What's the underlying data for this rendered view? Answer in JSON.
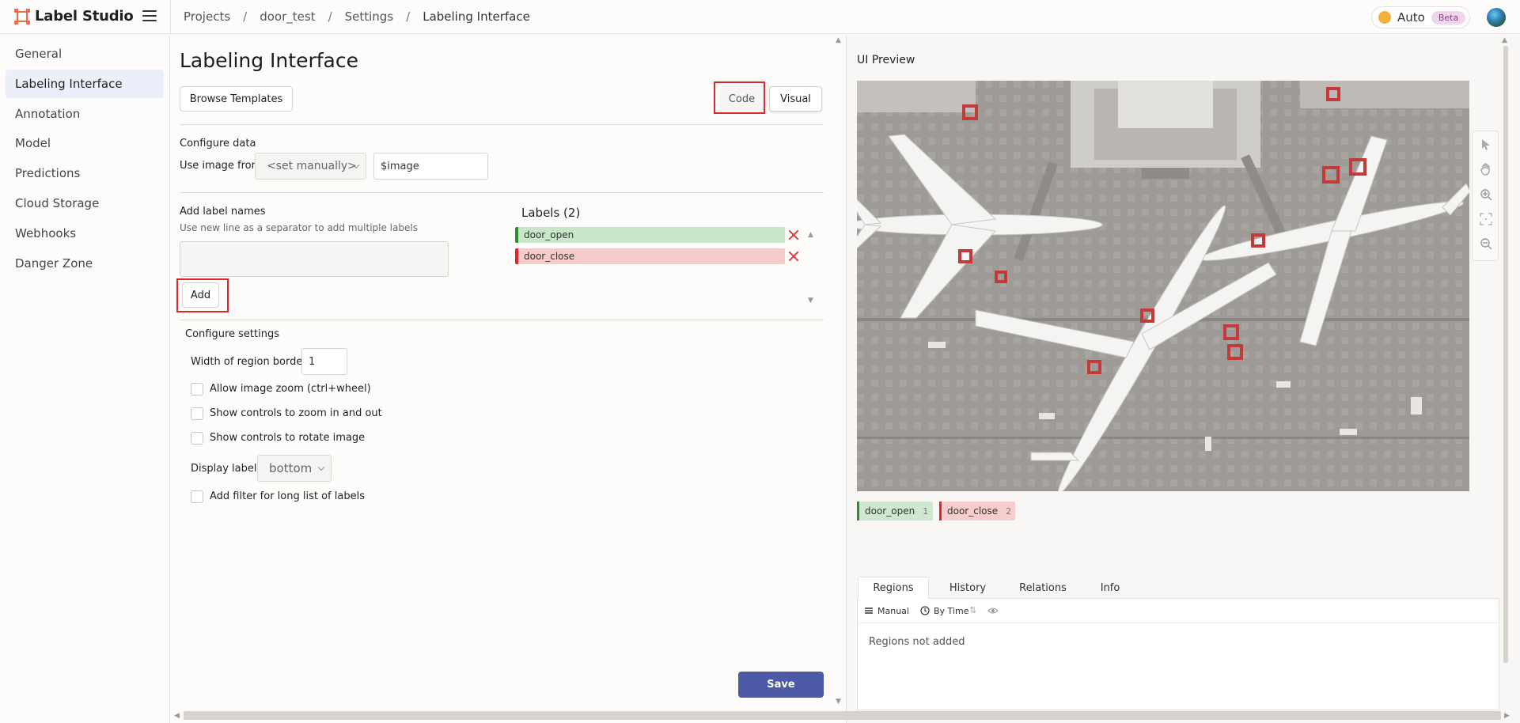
{
  "app": {
    "title": "Label Studio"
  },
  "breadcrumb": [
    "Projects",
    "door_test",
    "Settings",
    "Labeling Interface"
  ],
  "theme": {
    "label": "Auto",
    "badge": "Beta"
  },
  "sidebar": {
    "items": [
      {
        "label": "General"
      },
      {
        "label": "Labeling Interface",
        "active": true
      },
      {
        "label": "Annotation"
      },
      {
        "label": "Model"
      },
      {
        "label": "Predictions"
      },
      {
        "label": "Cloud Storage"
      },
      {
        "label": "Webhooks"
      },
      {
        "label": "Danger Zone"
      }
    ]
  },
  "main": {
    "title": "Labeling Interface",
    "browse_templates": "Browse Templates",
    "mode_code": "Code",
    "mode_visual": "Visual",
    "configure_data": {
      "heading": "Configure data",
      "use_image_from": "Use image from",
      "source_select": "<set manually>",
      "field_value": "$image"
    },
    "add_labels": {
      "heading": "Add label names",
      "hint": "Use new line as a separator to add multiple labels",
      "textarea_value": "",
      "add_button": "Add"
    },
    "labels": {
      "title": "Labels (2)",
      "items": [
        {
          "name": "door_open",
          "color": "#2f8f2f",
          "bg": "#c9e6c9"
        },
        {
          "name": "door_close",
          "color": "#e0262c",
          "bg": "#f7caca"
        }
      ]
    },
    "settings": {
      "heading": "Configure settings",
      "region_border_label": "Width of region borders",
      "region_border_value": "1",
      "checkboxes": [
        "Allow image zoom (ctrl+wheel)",
        "Show controls to zoom in and out",
        "Show controls to rotate image"
      ],
      "display_labels_label": "Display labels:",
      "display_labels_value": "bottom",
      "filter_checkbox": "Add filter for long list of labels"
    },
    "save": "Save"
  },
  "preview": {
    "title": "UI Preview",
    "legend": [
      {
        "name": "door_open",
        "count": "1",
        "color": "#2f8f2f",
        "bg": "#cfe7cf"
      },
      {
        "name": "door_close",
        "count": "2",
        "color": "#e0262c",
        "bg": "#f6cccc"
      }
    ],
    "tabs": [
      "Regions",
      "History",
      "Relations",
      "Info"
    ],
    "active_tab": "Regions",
    "order_manual": "Manual",
    "order_time": "By Time",
    "empty": "Regions not added"
  },
  "colors": {
    "accent": "#4d5ba6",
    "highlight": "#e0262c",
    "brand": "#ef6b4a"
  }
}
